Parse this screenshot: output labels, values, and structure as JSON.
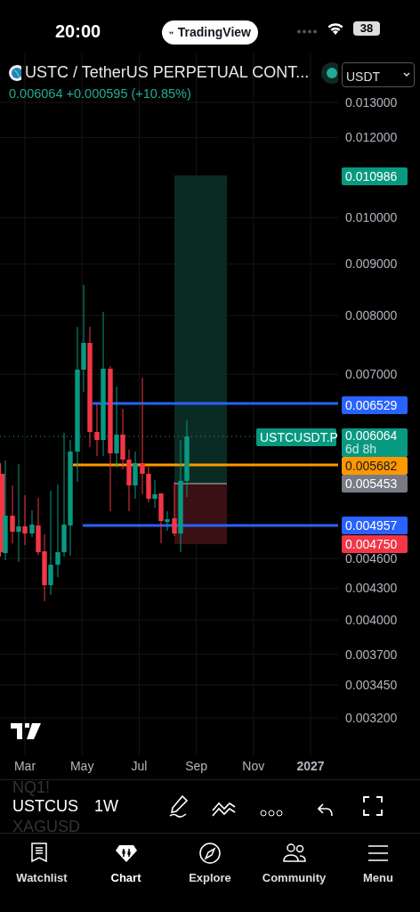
{
  "status_bar": {
    "time": "20:00",
    "app_pill": "TradingView",
    "battery": "38"
  },
  "header": {
    "title": "USTC / TetherUS PERPETUAL CONT...",
    "market_open": true,
    "currency": "USDT",
    "price": "0.006064",
    "change": "+0.000595 (+10.85%)"
  },
  "chart": {
    "price_ticks": [
      "0.013000",
      "0.012000",
      "0.010000",
      "0.009000",
      "0.008000",
      "0.007000",
      "0.004600",
      "0.004300",
      "0.004000",
      "0.003700",
      "0.003450",
      "0.003200"
    ],
    "price_markers": [
      {
        "kind": "price",
        "value": "0.010986",
        "color": "#089981"
      },
      {
        "kind": "price",
        "value": "0.006529",
        "color": "#2962ff"
      },
      {
        "kind": "last",
        "symbol": "USTCUSDT.P",
        "value": "0.006064",
        "countdown": "6d 8h",
        "color": "#089981"
      },
      {
        "kind": "price",
        "value": "0.005682",
        "color": "#ff9800"
      },
      {
        "kind": "price",
        "value": "0.005453",
        "color": "#787b86"
      },
      {
        "kind": "price",
        "value": "0.004957",
        "color": "#2962ff"
      },
      {
        "kind": "price",
        "value": "0.004750",
        "color": "#f23645"
      }
    ],
    "time_ticks": [
      {
        "label": "Mar",
        "year": false
      },
      {
        "label": "May",
        "year": false
      },
      {
        "label": "Jul",
        "year": false
      },
      {
        "label": "Sep",
        "year": false
      },
      {
        "label": "Nov",
        "year": false
      },
      {
        "label": "2027",
        "year": true
      }
    ]
  },
  "toolbar": {
    "previous_symbol": "NQ1!",
    "symbol": "USTCUS",
    "next_symbol": "XAGUSD",
    "interval": "1W"
  },
  "tab_bar": [
    {
      "label": "Watchlist",
      "selected": false
    },
    {
      "label": "Chart",
      "selected": true
    },
    {
      "label": "Explore",
      "selected": false
    },
    {
      "label": "Community",
      "selected": false
    },
    {
      "label": "Menu",
      "selected": false
    }
  ]
}
